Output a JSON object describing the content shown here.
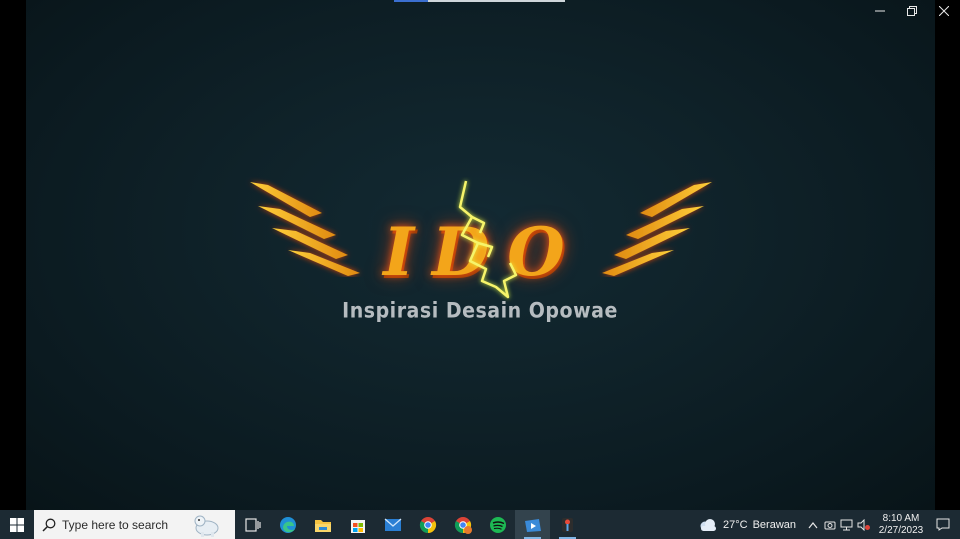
{
  "player": {
    "progress_fraction": 0.2
  },
  "window_controls": {
    "minimize_icon": "minimize-icon",
    "restore_icon": "restore-icon",
    "close_icon": "close-icon"
  },
  "logo": {
    "title": "IDO",
    "subtitle": "Inspirasi Desain Opowae",
    "colors": {
      "gold": "#f3a51a",
      "glow": "#ff5a14",
      "bolt": "#f2f25a",
      "subtitle": "#b6bcc0"
    }
  },
  "taskbar": {
    "search_placeholder": "Type here to search",
    "apps": [
      {
        "name": "task-view",
        "icon": "task-view-icon"
      },
      {
        "name": "edge",
        "icon": "edge-icon"
      },
      {
        "name": "file-explorer",
        "icon": "folder-icon"
      },
      {
        "name": "microsoft-store",
        "icon": "store-icon"
      },
      {
        "name": "mail",
        "icon": "mail-icon"
      },
      {
        "name": "chrome",
        "icon": "chrome-icon"
      },
      {
        "name": "chrome-profile",
        "icon": "chrome-profile-icon"
      },
      {
        "name": "spotify",
        "icon": "spotify-icon"
      },
      {
        "name": "media-player",
        "icon": "media-player-icon"
      },
      {
        "name": "app-tool",
        "icon": "app-tool-icon"
      }
    ],
    "weather": {
      "temperature": "27°C",
      "condition": "Berawan"
    },
    "clock": {
      "time": "8:10 AM",
      "date": "2/27/2023"
    }
  }
}
